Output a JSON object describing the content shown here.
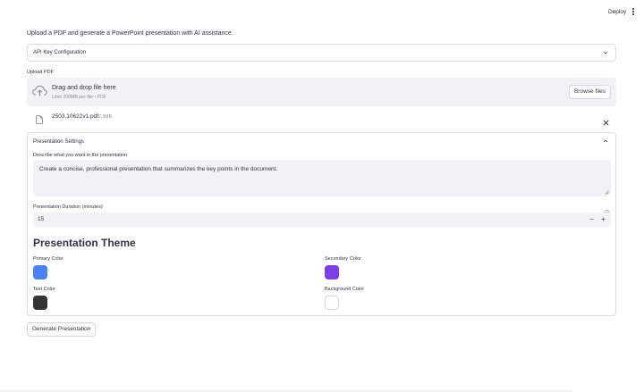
{
  "header": {
    "deploy_label": "Deploy"
  },
  "intro_text": "Upload a PDF and generate a PowerPoint presentation with AI assistance.",
  "api_expander": {
    "label": "API Key Configuration"
  },
  "upload": {
    "label": "Upload PDF",
    "dropzone_title": "Drag and drop file here",
    "dropzone_limit": "Limit 200MB per file • PDF",
    "browse_label": "Browse files",
    "file": {
      "name": "2503.10622v1.pdf",
      "size": "2.3MB"
    }
  },
  "settings": {
    "header": "Presentation Settings",
    "describe_label": "Describe what you want in the presentation",
    "describe_value": "Create a concise, professional presentation that summarizes the key points in the document.",
    "duration_label": "Presentation Duration (minutes)",
    "duration_value": "15",
    "minus_symbol": "−",
    "plus_symbol": "+",
    "theme_title": "Presentation Theme",
    "colors": {
      "primary": {
        "label": "Primary Color",
        "value": "#4a80f0"
      },
      "secondary": {
        "label": "Secondary Color",
        "value": "#7b3fe4"
      },
      "text": {
        "label": "Text Color",
        "value": "#333333"
      },
      "background": {
        "label": "Background Color",
        "value": "#ffffff"
      }
    }
  },
  "generate_label": "Generate Presentation",
  "icons": [
    "kebab-menu-icon",
    "chevron-down-icon",
    "chevron-up-icon",
    "cloud-upload-icon",
    "file-icon",
    "close-icon",
    "help-icon",
    "resize-handle-icon"
  ]
}
